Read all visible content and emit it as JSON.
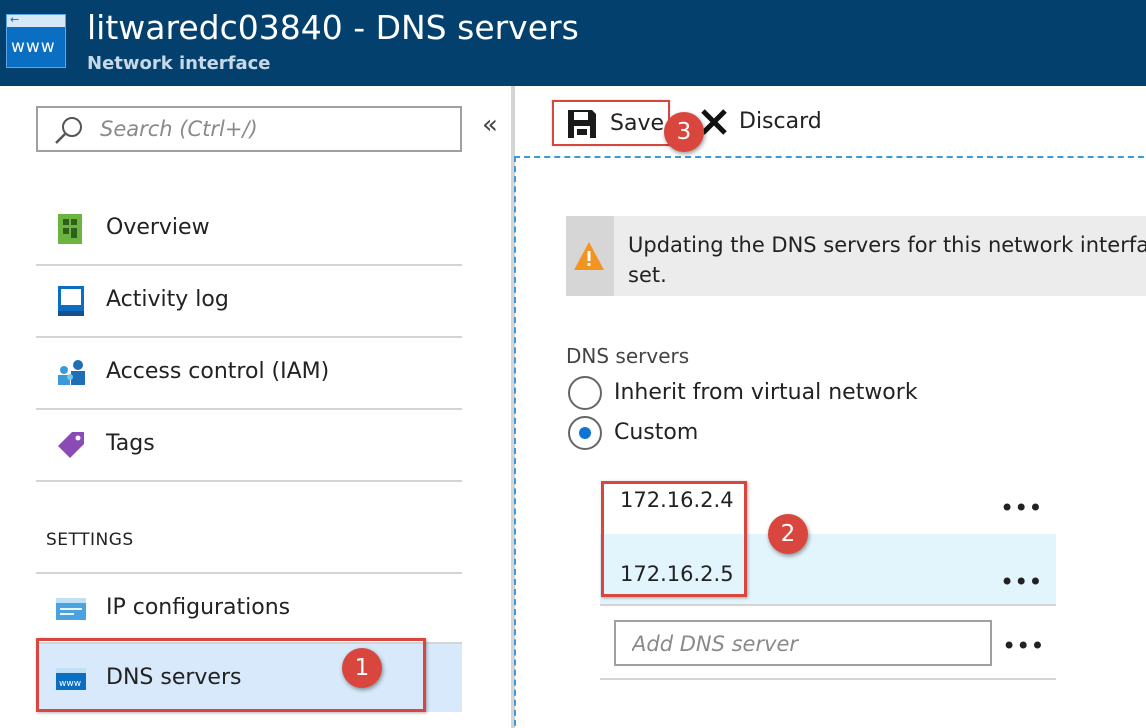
{
  "header": {
    "title": "litwaredc03840 - DNS servers",
    "subtitle": "Network interface",
    "icon": "www-network-interface-icon",
    "icon_text": "www",
    "icon_arrow": "←",
    "background_color": "#03406e"
  },
  "search": {
    "placeholder": "Search (Ctrl+/)",
    "value": ""
  },
  "collapse_glyph": "«",
  "nav": {
    "items": [
      {
        "label": "Overview",
        "icon": "overview-icon"
      },
      {
        "label": "Activity log",
        "icon": "activity-log-icon"
      },
      {
        "label": "Access control (IAM)",
        "icon": "access-control-icon"
      },
      {
        "label": "Tags",
        "icon": "tag-icon"
      }
    ],
    "settings_heading": "SETTINGS",
    "settings_items": [
      {
        "label": "IP configurations",
        "icon": "ip-configurations-icon"
      },
      {
        "label": "DNS servers",
        "icon": "dns-servers-icon",
        "active": true
      }
    ]
  },
  "toolbar": {
    "save_label": "Save",
    "discard_label": "Discard"
  },
  "warning": {
    "icon": "warning-icon",
    "line1": "Updating the DNS servers for this network interfa",
    "line2": "set."
  },
  "dns": {
    "label": "DNS servers",
    "options": [
      {
        "label": "Inherit from virtual network",
        "selected": false
      },
      {
        "label": "Custom",
        "selected": true
      }
    ],
    "servers": [
      {
        "ip": "172.16.2.4"
      },
      {
        "ip": "172.16.2.5"
      }
    ],
    "more_glyph": "•••",
    "add_placeholder": "Add DNS server"
  },
  "annotations": {
    "badge_1": "1",
    "badge_2": "2",
    "badge_3": "3",
    "highlight_color": "#d9463e"
  }
}
